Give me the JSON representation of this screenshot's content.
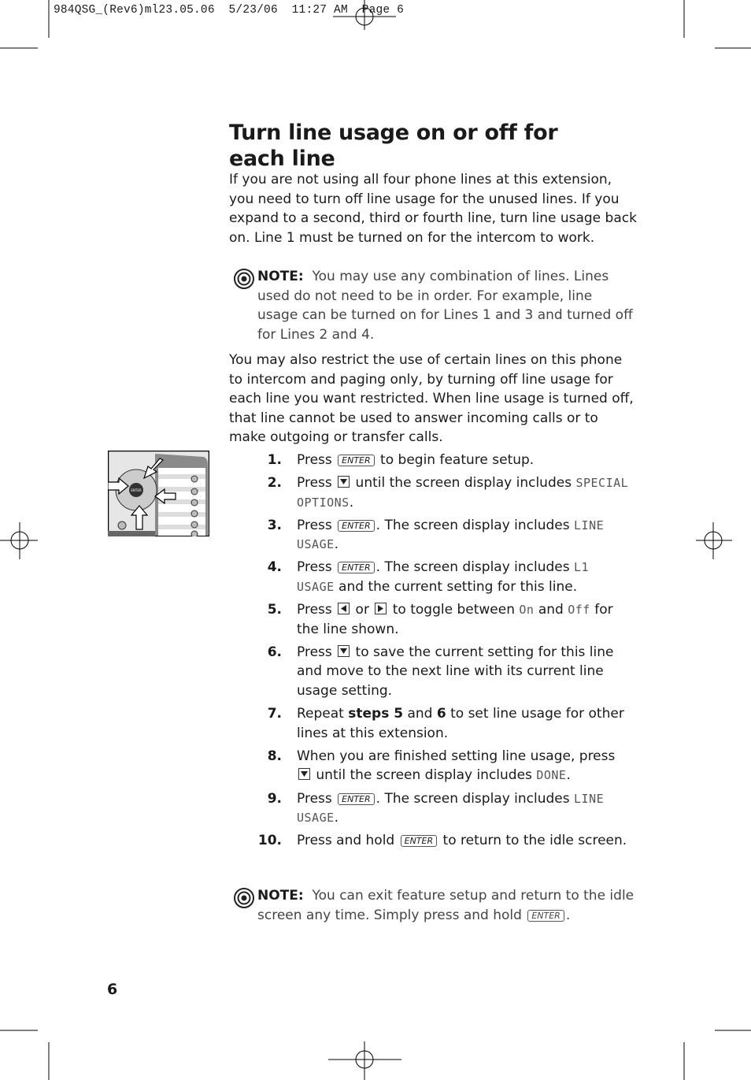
{
  "slug": "984QSG_(Rev6)ml23.05.06  5/23/06  11:27 AM  Page 6",
  "title": "Turn line usage on or off for each line",
  "intro": "If you are not using all four phone lines at this extension, you need to turn off line usage for the unused lines.  If you expand to a second,  third or fourth line,  turn line usage back on.  Line 1 must be turned on for the intercom to work.",
  "note1": {
    "label": "NOTE:",
    "text": "You may use any combination of lines.  Lines used do not need to be in order.  For example,  line usage can be turned on for Lines 1 and 3 and turned off for Lines 2 and 4."
  },
  "restrict": "You may also restrict the use of certain lines on this phone to intercom and paging only,  by turning off line usage for each line you want restricted.  When line usage is turned off, that line cannot be used to answer incoming calls or to make outgoing or transfer calls.",
  "steps": [
    {
      "num": "1.",
      "parts": [
        {
          "t": "Press "
        },
        {
          "key": "ENTER"
        },
        {
          "t": " to begin feature setup."
        }
      ]
    },
    {
      "num": "2.",
      "parts": [
        {
          "t": "Press "
        },
        {
          "arrow": "down"
        },
        {
          "t": " until the screen display includes "
        },
        {
          "lcd": "SPECIAL OPTIONS"
        },
        {
          "t": "."
        }
      ]
    },
    {
      "num": "3.",
      "parts": [
        {
          "t": "Press "
        },
        {
          "key": "ENTER"
        },
        {
          "t": ". The screen display includes "
        },
        {
          "lcd": "LINE USAGE"
        },
        {
          "t": "."
        }
      ]
    },
    {
      "num": "4.",
      "parts": [
        {
          "t": "Press "
        },
        {
          "key": "ENTER"
        },
        {
          "t": ". The screen display includes "
        },
        {
          "lcd": "L1 USAGE"
        },
        {
          "t": " and the current setting for this line."
        }
      ]
    },
    {
      "num": "5.",
      "parts": [
        {
          "t": "Press "
        },
        {
          "arrow": "left"
        },
        {
          "t": " or "
        },
        {
          "arrow": "right"
        },
        {
          "t": " to toggle between "
        },
        {
          "lcd": "On"
        },
        {
          "t": " and "
        },
        {
          "lcd": "Off"
        },
        {
          "t": " for the line shown."
        }
      ]
    },
    {
      "num": "6.",
      "parts": [
        {
          "t": "Press "
        },
        {
          "arrow": "down"
        },
        {
          "t": " to save the current setting for this line and move to the next line with its current line usage setting."
        }
      ]
    },
    {
      "num": "7.",
      "parts": [
        {
          "t": "Repeat "
        },
        {
          "b": "steps 5"
        },
        {
          "t": " and "
        },
        {
          "b": "6"
        },
        {
          "t": " to set line usage for other lines at this extension."
        }
      ]
    },
    {
      "num": "8.",
      "parts": [
        {
          "t": "When you are finished setting line usage, press "
        },
        {
          "arrow": "down"
        },
        {
          "t": " until the screen display includes "
        },
        {
          "lcd": "DONE"
        },
        {
          "t": "."
        }
      ]
    },
    {
      "num": "9.",
      "parts": [
        {
          "t": "Press "
        },
        {
          "key": "ENTER"
        },
        {
          "t": ". The screen display includes "
        },
        {
          "lcd": "LINE USAGE"
        },
        {
          "t": "."
        }
      ]
    },
    {
      "num": "10.",
      "parts": [
        {
          "t": "Press and hold "
        },
        {
          "key": "ENTER"
        },
        {
          "t": " to return to the idle screen."
        }
      ]
    }
  ],
  "note2": {
    "label": "NOTE:",
    "text": "You can exit feature setup and return to the idle screen any time.  Simply press and hold ",
    "key": "ENTER",
    "end": "."
  },
  "page_number": "6",
  "phone_image": {
    "enter_label": "ENTER"
  }
}
